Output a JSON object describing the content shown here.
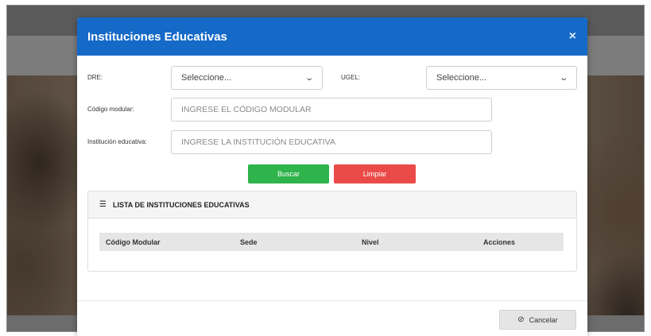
{
  "modal": {
    "title": "Instituciones Educativas",
    "close_glyph": "×"
  },
  "form": {
    "dre_label": "DRE:",
    "dre_value": "Seleccione...",
    "ugel_label": "UGEL:",
    "ugel_value": "Seleccione...",
    "codigo_label": "Código modular:",
    "codigo_placeholder": "INGRESE EL CÓDIGO MODULAR",
    "institucion_label": "Institución educativa:",
    "institucion_placeholder": "INGRESE LA INSTITUCIÓN EDUCATIVA",
    "chevron_glyph": "⌄"
  },
  "buttons": {
    "search_label": "Buscar",
    "clear_label": "Limpiar",
    "cancel_label": "Cancelar",
    "cancel_icon": "⊘"
  },
  "list": {
    "title": "LISTA DE INSTITUCIONES EDUCATIVAS",
    "icon": "☰",
    "columns": [
      "Código Modular",
      "Sede",
      "Nivel",
      "Acciones"
    ]
  },
  "colors": {
    "header_blue": "#1569c7",
    "search_green": "#2fb34b",
    "clear_red": "#ea4b49"
  }
}
